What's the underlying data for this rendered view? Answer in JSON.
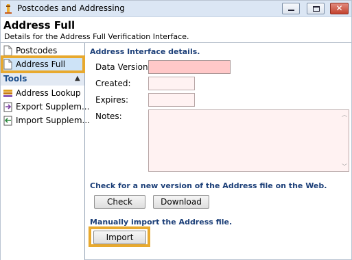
{
  "window": {
    "title": "Postcodes and Addressing"
  },
  "header": {
    "title": "Address Full",
    "subtitle": "Details for the Address Full Verification Interface."
  },
  "sidebar": {
    "items": [
      {
        "label": "Postcodes",
        "icon": "document-icon"
      },
      {
        "label": "Address Full",
        "icon": "document-icon",
        "selected": true
      }
    ],
    "tools_header": "Tools",
    "tools": [
      {
        "label": "Address Lookup",
        "icon": "address-lookup-icon"
      },
      {
        "label": "Export Supplem...",
        "icon": "export-icon"
      },
      {
        "label": "Import Supplem...",
        "icon": "import-icon"
      }
    ]
  },
  "main": {
    "section_details": "Address Interface details.",
    "fields": {
      "data_version_label": "Data Version:",
      "data_version_value": "",
      "created_label": "Created:",
      "created_value": "",
      "expires_label": "Expires:",
      "expires_value": "",
      "notes_label": "Notes:",
      "notes_value": ""
    },
    "section_web": "Check for a new version of the Address file on the Web.",
    "check_button": "Check",
    "download_button": "Download",
    "section_import": "Manually import the Address file.",
    "import_button": "Import"
  },
  "colors": {
    "highlight": "#e8a92e",
    "required_field": "#ffc8c8",
    "optional_field": "#fff2f2",
    "section_title": "#1c3f78"
  }
}
